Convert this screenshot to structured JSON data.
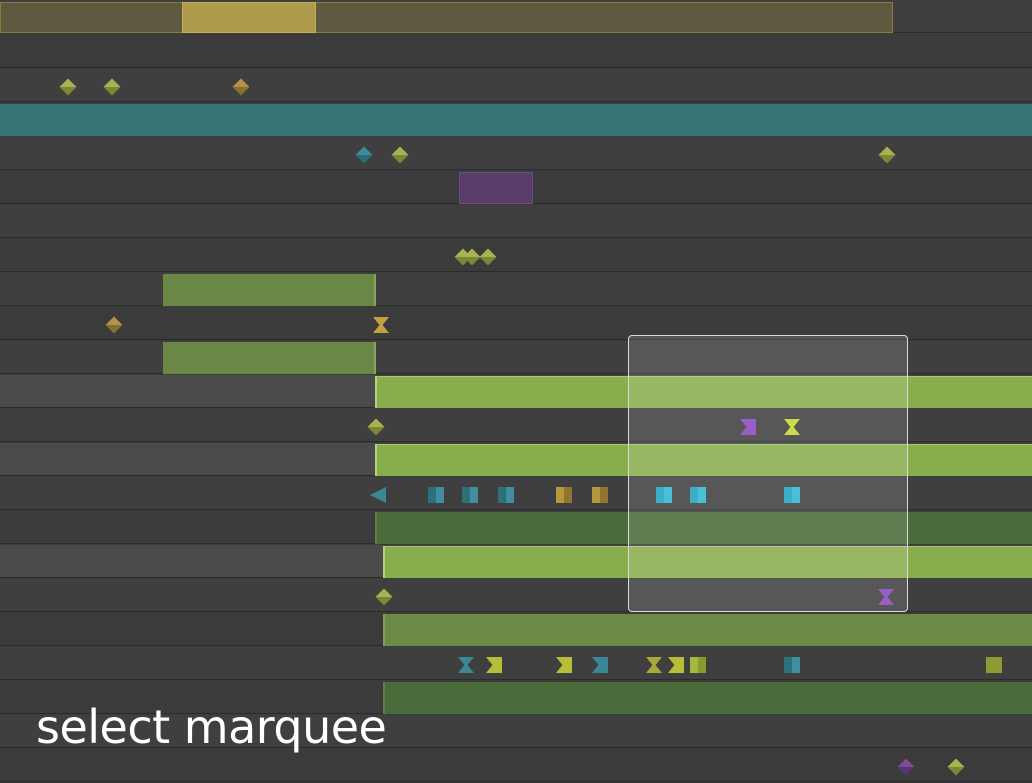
{
  "caption": {
    "text": "select marquee"
  },
  "colors": {
    "background": "#3c3c3c",
    "track": "#3f3f3f",
    "teal_bar": "#357578",
    "lime_bar": "#88ad4d",
    "marquee_border": "#d9d9d9"
  },
  "icons": {
    "diamond": "diamond-keyframe-icon",
    "square": "square-keyframe-icon",
    "hourglass": "hourglass-keyframe-icon",
    "flag": "flag-keyframe-icon"
  }
}
